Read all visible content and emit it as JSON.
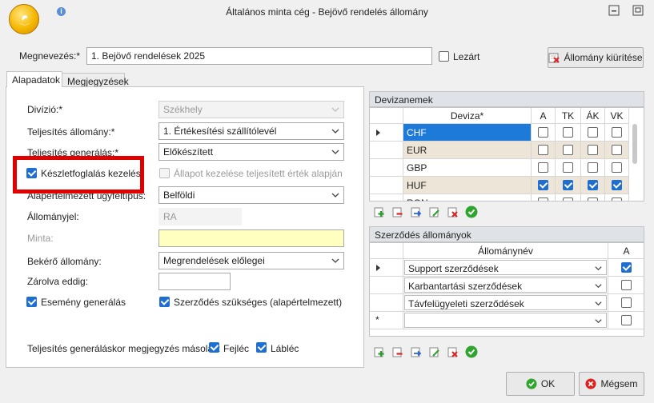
{
  "window": {
    "title": "Általános minta cég - Bejövő rendelés állomány"
  },
  "header": {
    "name_label": "Megnevezés:*",
    "name_value": "1. Bejövő rendelések 2025",
    "locked_label": "Lezárt",
    "locked_checked": false,
    "clear_button_label": "Állomány kiürítése"
  },
  "tabs": [
    {
      "label": "Alapadatok",
      "active": true
    },
    {
      "label": "Megjegyzések",
      "active": false
    }
  ],
  "form": {
    "division_label": "Divízió:*",
    "division_value": "Székhely",
    "fulfillment_ledger_label": "Teljesítés állomány:*",
    "fulfillment_ledger_value": "1. Értékesítési szállítólevél",
    "fulfillment_generation_label": "Teljesítés generálás:*",
    "fulfillment_generation_value": "Előkészített",
    "stock_reservation_label": "Készletfoglalás kezelés",
    "stock_reservation_checked": true,
    "state_handling_label": "Állapot kezelése teljesített érték alapján",
    "state_handling_checked": false,
    "default_client_type_label": "Alapértelmezett ügyféltípus:",
    "default_client_type_value": "Belföldi",
    "ledger_mark_label": "Állományjel:",
    "ledger_mark_value": "RA",
    "template_label": "Minta:",
    "template_value": "",
    "request_ledger_label": "Bekérő állomány:",
    "request_ledger_value": "Megrendelések előlegei",
    "locked_until_label": "Zárolva eddig:",
    "locked_until_value": "",
    "event_generation_label": "Esemény generálás",
    "event_generation_checked": true,
    "contract_required_label": "Szerződés szükséges (alapértelmezett)",
    "contract_required_checked": true,
    "note_copy_label": "Teljesítés generáláskor megjegyzés másolás:",
    "header_note_label": "Fejléc",
    "header_note_checked": true,
    "footer_note_label": "Lábléc",
    "footer_note_checked": true
  },
  "currencies": {
    "title": "Devizanemek",
    "columns": [
      "Deviza*",
      "A",
      "TK",
      "ÁK",
      "VK"
    ],
    "rows": [
      {
        "code": "CHF",
        "A": false,
        "TK": false,
        "AK": false,
        "VK": false,
        "selected": true
      },
      {
        "code": "EUR",
        "A": false,
        "TK": false,
        "AK": false,
        "VK": false
      },
      {
        "code": "GBP",
        "A": false,
        "TK": false,
        "AK": false,
        "VK": false
      },
      {
        "code": "HUF",
        "A": true,
        "TK": true,
        "AK": true,
        "VK": true
      },
      {
        "code": "RON",
        "A": false,
        "TK": false,
        "AK": false,
        "VK": false
      }
    ]
  },
  "contracts": {
    "title": "Szerződés állományok",
    "columns": [
      "Állománynév",
      "A"
    ],
    "rows": [
      {
        "name": "Support szerződések",
        "A": true
      },
      {
        "name": "Karbantartási szerződések",
        "A": false
      },
      {
        "name": "Távfelügyeleti szerződések",
        "A": false
      },
      {
        "name": "",
        "A": false
      }
    ]
  },
  "footer": {
    "ok_label": "OK",
    "cancel_label": "Mégsem"
  },
  "colors": {
    "accent": "#1e7ad8",
    "highlight": "#e00000",
    "template_bg": "#ffffc0"
  }
}
